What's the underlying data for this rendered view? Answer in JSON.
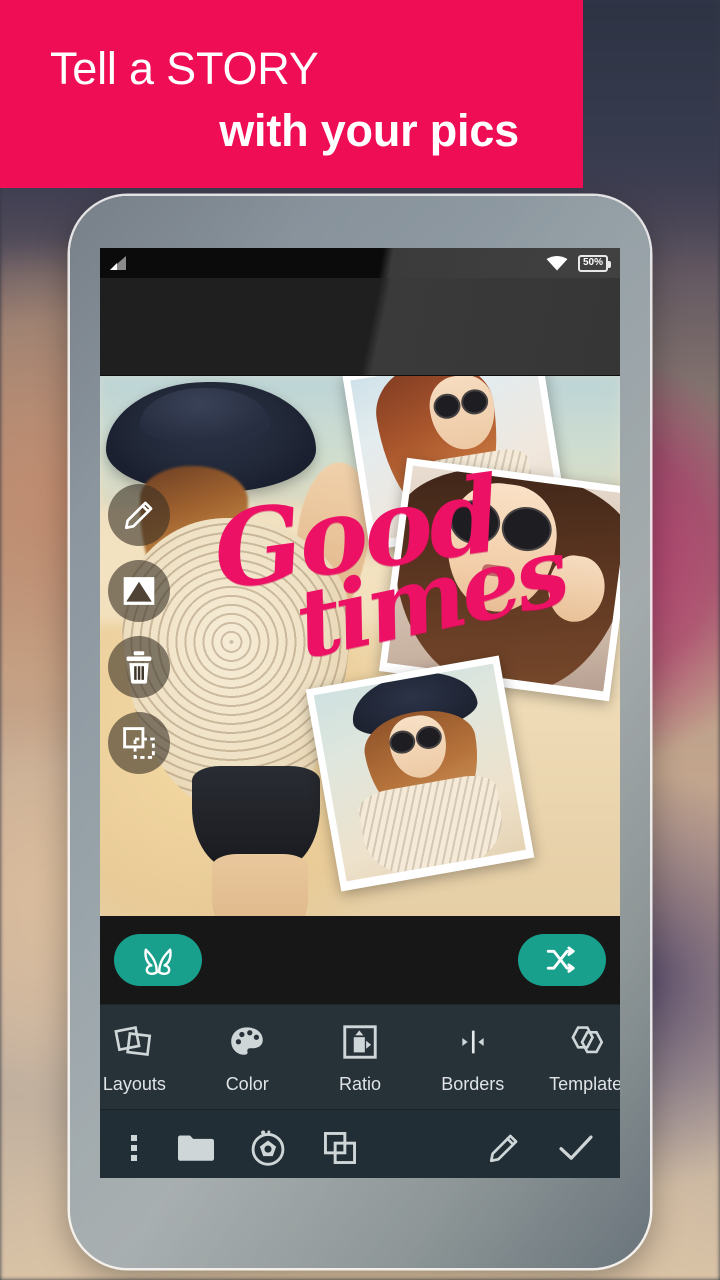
{
  "banner": {
    "line1": "Tell a STORY",
    "line2": "with your pics",
    "bg_color": "#ef0d55",
    "text_color": "#ffffff"
  },
  "phone": {
    "status_bar": {
      "signal_icon": "signal-bars-icon",
      "wifi_icon": "wifi-icon",
      "battery_level": "50%"
    }
  },
  "canvas": {
    "overlay_text": {
      "word1": "Good",
      "word2": "times",
      "color": "#ec1164"
    },
    "side_tools": [
      {
        "name": "edit-tool",
        "icon": "pencil-icon"
      },
      {
        "name": "image-tool",
        "icon": "mountain-icon"
      },
      {
        "name": "delete-tool",
        "icon": "trash-icon"
      },
      {
        "name": "duplicate-tool",
        "icon": "duplicate-icon"
      }
    ]
  },
  "action_row": {
    "left_button": {
      "name": "effects-button",
      "icon": "butterfly-icon"
    },
    "right_button": {
      "name": "shuffle-button",
      "icon": "shuffle-icon"
    },
    "accent_color": "#18a08c"
  },
  "tools": [
    {
      "label": "Layouts",
      "icon": "layouts-icon"
    },
    {
      "label": "Color",
      "icon": "palette-icon"
    },
    {
      "label": "Ratio",
      "icon": "ratio-icon"
    },
    {
      "label": "Borders",
      "icon": "borders-icon"
    },
    {
      "label": "Template",
      "icon": "template-icon"
    }
  ],
  "navbar": {
    "left_items": [
      {
        "name": "overflow-menu-button",
        "icon": "more-vertical-icon"
      },
      {
        "name": "folder-button",
        "icon": "folder-icon"
      },
      {
        "name": "camera-button",
        "icon": "aperture-icon"
      },
      {
        "name": "layers-button",
        "icon": "copy-icon"
      }
    ],
    "right_items": [
      {
        "name": "draw-button",
        "icon": "pencil-icon"
      },
      {
        "name": "confirm-button",
        "icon": "check-icon"
      }
    ]
  }
}
